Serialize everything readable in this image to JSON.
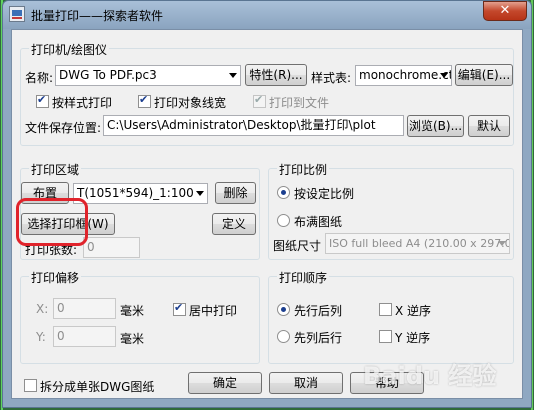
{
  "window": {
    "title": "批量打印——探索者软件",
    "close_label": "✕"
  },
  "printer": {
    "group_label": "打印机/绘图仪",
    "name_label": "名称:",
    "name_value": "DWG To PDF.pc3",
    "props_button": "特性(R)...",
    "style_label": "样式表:",
    "style_value": "monochrome.ctl",
    "edit_button": "编辑(E)...",
    "cb_style_label": "按样式打印",
    "cb_lineweight_label": "打印对象线宽",
    "cb_tofile_label": "打印到文件",
    "path_label": "文件保存位置:",
    "path_value": "C:\\Users\\Administrator\\Desktop\\批量打印\\plot",
    "browse_button": "浏览(B)...",
    "default_button": "默认"
  },
  "area": {
    "group_label": "打印区域",
    "layout_button": "布置",
    "frame_value": "T(1051*594)_1:100",
    "delete_button": "删除",
    "select_button": "选择打印框(W)",
    "define_button": "定义",
    "count_label": "打印张数:",
    "count_value": "0"
  },
  "scale": {
    "group_label": "打印比例",
    "radio1_label": "按设定比例",
    "radio2_label": "布满图纸",
    "paper_label": "图纸尺寸",
    "paper_value": "ISO full bleed A4 (210.00 x 297.0"
  },
  "offset": {
    "group_label": "打印偏移",
    "x_label": "X:",
    "x_value": "0",
    "x_unit": "毫米",
    "center_label": "居中打印",
    "y_label": "Y:",
    "y_value": "0",
    "y_unit": "毫米"
  },
  "order": {
    "group_label": "打印顺序",
    "row_first_label": "先行后列",
    "col_first_label": "先列后行",
    "x_reverse_label": "X 逆序",
    "y_reverse_label": "Y 逆序"
  },
  "footer": {
    "split_label": "拆分成单张DWG图纸",
    "ok_button": "确定",
    "cancel_button": "取消",
    "help_button": "帮助"
  },
  "watermark": "Baidu 经验"
}
